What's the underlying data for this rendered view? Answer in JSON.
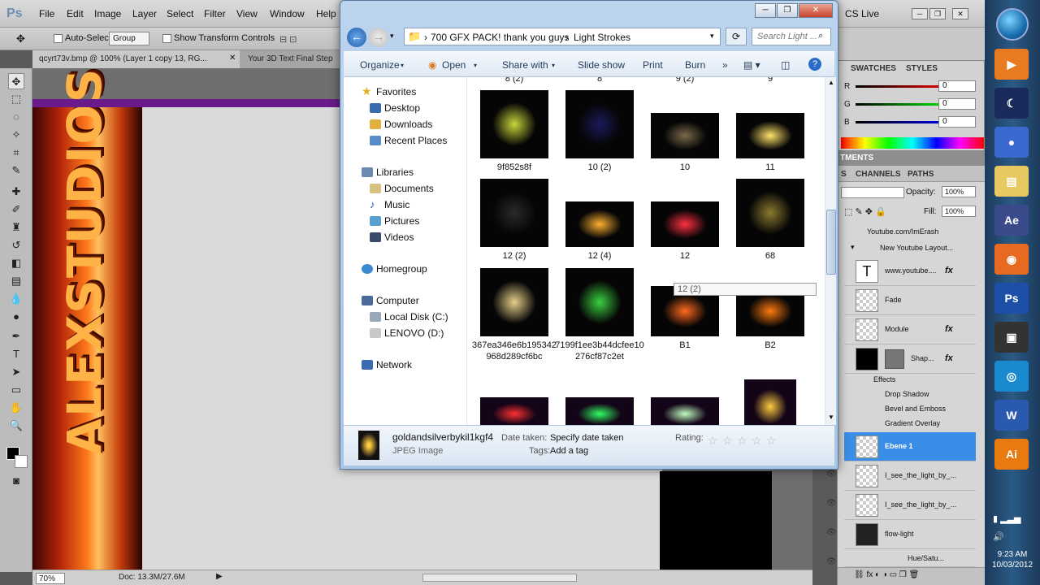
{
  "photoshop": {
    "logo": "Ps",
    "menu": [
      "File",
      "Edit",
      "Image",
      "Layer",
      "Select",
      "Filter",
      "View",
      "Window",
      "Help"
    ],
    "options": {
      "auto_select_label": "Auto-Select:",
      "auto_select_value": "Group",
      "transform_label": "Show Transform Controls"
    },
    "tabs": [
      "qcyrt73v.bmp @ 100% (Layer 1 copy 13, RG...",
      "Your 3D Text Final Step"
    ],
    "status": {
      "zoom": "70%",
      "doc": "Doc: 13.3M/27.6M"
    },
    "cs_live": "CS Live",
    "artwork_text": "ALEXSTUDIOS"
  },
  "explorer": {
    "address": [
      "700 GFX PACK! thank you guys",
      "Light Strokes"
    ],
    "search_placeholder": "Search Light ...",
    "commands": [
      "Organize",
      "Open",
      "Share with",
      "Slide show",
      "Print",
      "Burn",
      "»"
    ],
    "nav": {
      "favorites": "Favorites",
      "favorites_items": [
        "Desktop",
        "Downloads",
        "Recent Places"
      ],
      "libraries": "Libraries",
      "libraries_items": [
        "Documents",
        "Music",
        "Pictures",
        "Videos"
      ],
      "homegroup": "Homegroup",
      "computer": "Computer",
      "computer_items": [
        "Local Disk (C:)",
        "LENOVO (D:)"
      ],
      "network": "Network"
    },
    "top_captions": [
      "8 (2)",
      "8",
      "9 (2)",
      "9"
    ],
    "files": [
      {
        "name": "9f852s8f",
        "glow": "#c9d63a"
      },
      {
        "name": "10 (2)",
        "glow": "#1a1a5a"
      },
      {
        "name": "10",
        "glow": "#7a6a4a"
      },
      {
        "name": "11",
        "glow": "#ffe36a"
      },
      {
        "name": "12 (2)",
        "glow": "#2a2a2a"
      },
      {
        "name": "12 (4)",
        "glow": "#ffb030"
      },
      {
        "name": "12",
        "glow": "#ff3040"
      },
      {
        "name": "68",
        "glow": "#8a7a30"
      },
      {
        "name": "367ea346e6b195342968d289cf6bc",
        "glow": "#e8d08a"
      },
      {
        "name": "7199f1ee3b44dcfee10276cf87c2et",
        "glow": "#3cd040"
      },
      {
        "name": "B1",
        "glow": "#ff6a20"
      },
      {
        "name": "B2",
        "glow": "#ff7a10"
      }
    ],
    "bottom_row_glows": [
      "#ff3030",
      "#30ff60",
      "#c0ffc0",
      "#ffcc40"
    ],
    "tooltip": "12 (2)",
    "details": {
      "filename": "goldandsilverbykil1kgf4",
      "type": "JPEG Image",
      "date_label": "Date taken:",
      "date_value": "Specify date taken",
      "tags_label": "Tags:",
      "tags_value": "Add a tag",
      "rating_label": "Rating:",
      "stars": [
        "☆",
        "☆",
        "☆",
        "☆",
        "☆"
      ]
    }
  },
  "panels": {
    "swatch_tabs": [
      "SWATCHES",
      "STYLES"
    ],
    "rgb": [
      {
        "label": "R",
        "value": "0"
      },
      {
        "label": "G",
        "value": "0"
      },
      {
        "label": "B",
        "value": "0"
      }
    ],
    "adjustments_tab": "TMENTS",
    "layer_tabs": [
      "S",
      "CHANNELS",
      "PATHS"
    ],
    "opacity_label": "Opacity:",
    "opacity_value": "100%",
    "fill_label": "Fill:",
    "fill_value": "100%",
    "layers": [
      {
        "name": "Youtube.com/ImErash",
        "fx": ""
      },
      {
        "name": "New Youtube Layout...",
        "fx": ""
      },
      {
        "name": "www.youtube....",
        "fx": "fx"
      },
      {
        "name": "Fade",
        "fx": ""
      },
      {
        "name": "Module",
        "fx": "fx"
      },
      {
        "name": "Shap...",
        "fx": "fx"
      }
    ],
    "effects_label": "Effects",
    "effects": [
      "Drop Shadow",
      "Bevel and Emboss",
      "Gradient Overlay"
    ],
    "layers_lower": [
      {
        "name": "Ebene 1"
      },
      {
        "name": "I_see_the_light_by_..."
      },
      {
        "name": "I_see_the_light_by_..."
      },
      {
        "name": "flow-light"
      },
      {
        "name": "Hue/Satu..."
      }
    ]
  },
  "taskbar": {
    "icons": [
      "▶",
      "☾",
      "●",
      "▤",
      "Ae",
      "◉",
      "Ps",
      "▣",
      "◎",
      "W",
      "Ai"
    ],
    "icon_colors": [
      "#e87a20",
      "#1a2a5a",
      "#3a6ad0",
      "#e8c860",
      "#3a4a8a",
      "#e86a20",
      "#1e4fa8",
      "#333",
      "#1a8ad0",
      "#2a5ab0",
      "#e87a10"
    ],
    "time": "9:23 AM",
    "date": "10/03/2012"
  }
}
